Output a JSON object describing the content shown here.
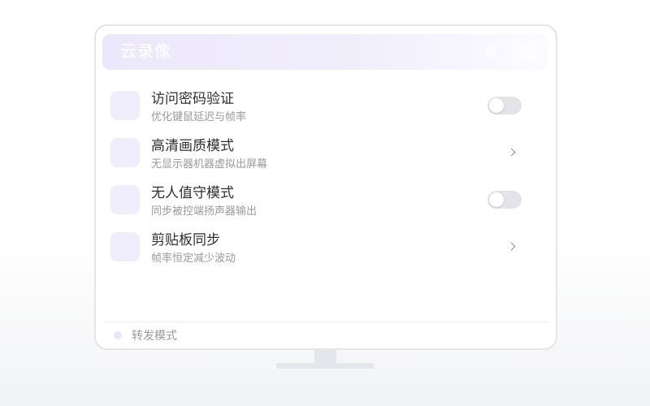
{
  "window": {
    "title": "云录像"
  },
  "colors": {
    "accent": "#ece8fb",
    "icon_tile": "#f0edfc",
    "toggle_off": "#e2e4e8",
    "title_text": "#2f2f2f",
    "subtitle_text": "#9a9a9a",
    "frame_border": "#e3e5e9",
    "dot": "#e9e6fb"
  },
  "settings": {
    "items": [
      {
        "title": "访问密码验证",
        "subtitle": "优化键鼠延迟与帧率",
        "toggle_on": false
      },
      {
        "title": "高清画质模式",
        "subtitle": "无显示器机器虚拟出屏幕",
        "icon": "chevron-right-icon"
      },
      {
        "title": "无人值守模式",
        "subtitle": "同步被控端扬声器输出",
        "toggle_on": false
      },
      {
        "title": "剪贴板同步",
        "subtitle": "帧率恒定减少波动",
        "icon": "chevron-right-icon"
      }
    ]
  },
  "footer": {
    "label": "转发模式",
    "icon": "status-dot-icon"
  }
}
